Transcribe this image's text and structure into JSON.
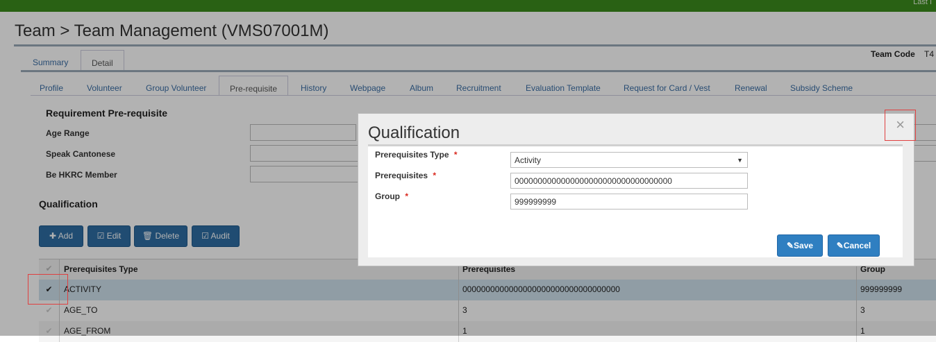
{
  "topbar": {
    "last_label": "Last I"
  },
  "page": {
    "title": "Team > Team Management (VMS07001M)"
  },
  "tabs_level1": [
    {
      "label": "Summary"
    },
    {
      "label": "Detail"
    }
  ],
  "team_code": {
    "label": "Team Code",
    "value": "T4"
  },
  "tabs_level2": [
    {
      "label": "Profile"
    },
    {
      "label": "Volunteer"
    },
    {
      "label": "Group Volunteer"
    },
    {
      "label": "Pre-requisite"
    },
    {
      "label": "History"
    },
    {
      "label": "Webpage"
    },
    {
      "label": "Album"
    },
    {
      "label": "Recruitment"
    },
    {
      "label": "Evaluation Template"
    },
    {
      "label": "Request for Card / Vest"
    },
    {
      "label": "Renewal"
    },
    {
      "label": "Subsidy Scheme"
    }
  ],
  "requirement": {
    "heading": "Requirement Pre-requisite",
    "fields": [
      {
        "label": "Age Range"
      },
      {
        "label": "Speak Cantonese"
      },
      {
        "label": "Be HKRC Member"
      }
    ]
  },
  "qualification": {
    "heading": "Qualification",
    "buttons": {
      "add": "Add",
      "edit": "Edit",
      "delete": "Delete",
      "audit": "Audit"
    },
    "columns": [
      "Prerequisites Type",
      "Prerequisites",
      "Group"
    ],
    "rows": [
      {
        "type": "ACTIVITY",
        "prereq": "0000000000000000000000000000000000",
        "group": "999999999",
        "selected": true
      },
      {
        "type": "AGE_TO",
        "prereq": "3",
        "group": "3",
        "selected": false
      },
      {
        "type": "AGE_FROM",
        "prereq": "1",
        "group": "1",
        "selected": false
      }
    ]
  },
  "modal": {
    "title": "Qualification",
    "close_glyph": "×",
    "fields": {
      "type": {
        "label": "Prerequisites Type",
        "value": "Activity"
      },
      "prereq": {
        "label": "Prerequisites",
        "value": "0000000000000000000000000000000000"
      },
      "group": {
        "label": "Group",
        "value": "999999999"
      }
    },
    "required_mark": "*",
    "save_label": "Save",
    "cancel_label": "Cancel"
  }
}
